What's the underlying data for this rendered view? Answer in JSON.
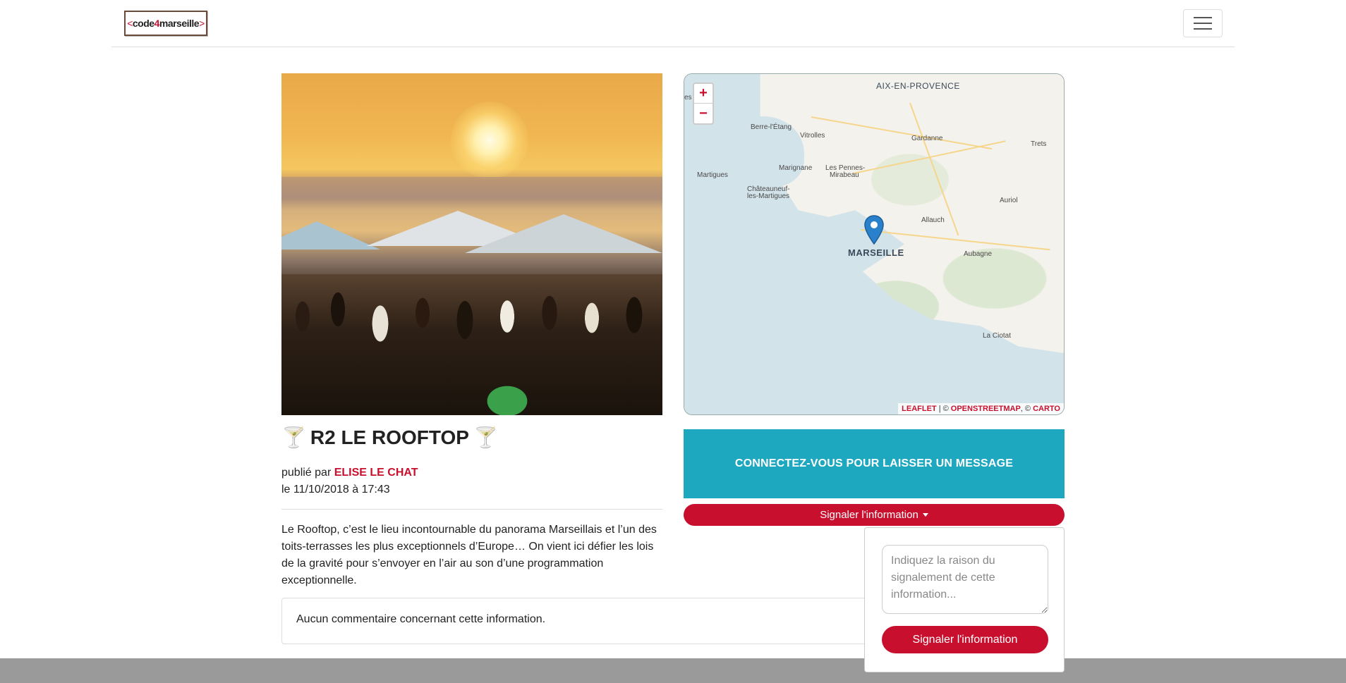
{
  "navbar": {
    "logo_left_bracket": "<",
    "logo_text_a": "code",
    "logo_text_four": "4",
    "logo_text_b": "marseille",
    "logo_right_bracket": ">",
    "menu_icon": "hamburger-icon"
  },
  "map": {
    "zoom_in": "+",
    "zoom_out": "−",
    "places": {
      "aix": "AIX-EN-PROVENCE",
      "berre": "Berre-l'Étang",
      "vitrolles": "Vitrolles",
      "gardanne": "Gardanne",
      "trets": "Trets",
      "martigues": "Martigues",
      "marignane": "Marignane",
      "pennes1": "Les Pennes-",
      "pennes2": "Mirabeau",
      "chateau1": "Châteauneuf-",
      "chateau2": "les-Martigues",
      "auriol": "Auriol",
      "allauch": "Allauch",
      "marseille": "MARSEILLE",
      "aubagne": "Aubagne",
      "ciotat": "La Ciotat",
      "edge": "es"
    },
    "attribution": {
      "leaflet": "LEAFLET",
      "sep1": " | © ",
      "osm": "OPENSTREETMAP",
      "sep2": ", © ",
      "carto": "CARTO"
    },
    "marker_icon": "map-marker-icon"
  },
  "post": {
    "title": "R2 LE ROOFTOP",
    "title_icon_left": "🍸",
    "title_icon_right": "🍸",
    "published_prefix": "publié par ",
    "author": "ELISE LE CHAT",
    "date": "le 11/10/2018 à 17:43",
    "description": "Le Rooftop, c’est le lieu incontournable du panorama Marseillais et l’un des toits-terrasses les plus exceptionnels d’Europe… On vient ici défier les lois de la gravité pour s’envoyer en l’air au son d’une programmation exceptionnelle."
  },
  "comments": {
    "empty": "Aucun commentaire concernant cette information."
  },
  "actions": {
    "connect": "CONNECTEZ-VOUS POUR LAISSER UN MESSAGE",
    "report_toggle": "Signaler l'information",
    "report_placeholder": "Indiquez la raison du signalement de cette information...",
    "report_submit": "Signaler l'information"
  },
  "colors": {
    "accent": "#c8102e",
    "connect_bg": "#1ea8bf",
    "footer": "#9a9a9a"
  }
}
